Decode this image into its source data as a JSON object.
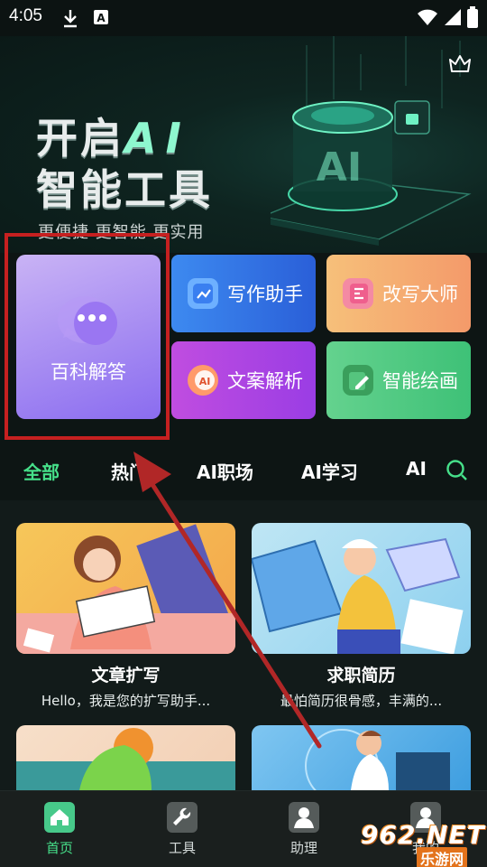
{
  "status_bar": {
    "time": "4:05"
  },
  "hero": {
    "title_line1_a": "开启",
    "title_line1_b": "AI",
    "title_line2": "智能工具",
    "subtitle": "更便捷 更智能 更实用",
    "badge_text": "AI"
  },
  "tools": [
    {
      "label": "百科解答",
      "icon": "chat-bubble-icon"
    },
    {
      "label": "写作助手",
      "icon": "chart-document-icon"
    },
    {
      "label": "改写大师",
      "icon": "edit-document-icon"
    },
    {
      "label": "文案解析",
      "icon": "ai-badge-icon"
    },
    {
      "label": "智能绘画",
      "icon": "pencil-icon"
    }
  ],
  "tabs": [
    {
      "label": "全部",
      "active": true
    },
    {
      "label": "热门"
    },
    {
      "label": "AI职场"
    },
    {
      "label": "AI学习"
    },
    {
      "label": "AI"
    }
  ],
  "cards": [
    {
      "title": "文章扩写",
      "desc": "Hello，我是您的扩写助手..."
    },
    {
      "title": "求职简历",
      "desc": "最怕简历很骨感，丰满的..."
    }
  ],
  "bottom_nav": [
    {
      "label": "首页",
      "icon": "home-icon",
      "active": true
    },
    {
      "label": "工具",
      "icon": "wrench-icon"
    },
    {
      "label": "助理",
      "icon": "assistant-icon"
    },
    {
      "label": "我的",
      "icon": "profile-icon"
    }
  ],
  "watermark": {
    "big": "962.NET",
    "small": "乐游网"
  },
  "colors": {
    "accent": "#46e08a",
    "highlight_box": "#c62020",
    "arrow": "#b12727"
  }
}
